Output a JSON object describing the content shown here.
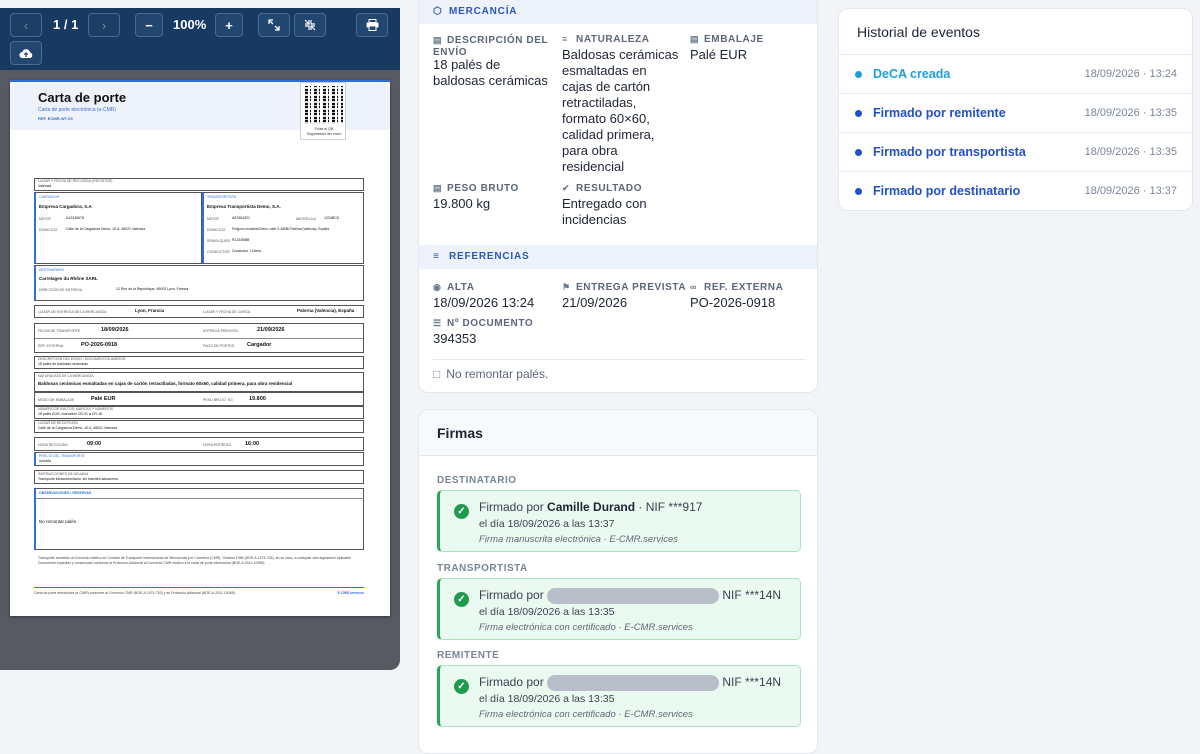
{
  "viewer": {
    "page_indicator": "1 / 1",
    "zoom": "100%",
    "prev_icon": "chevron-left-icon",
    "next_icon": "chevron-right-icon",
    "zoom_out_label": "−",
    "zoom_in_label": "+",
    "fullscreen_icon": "expand-icon",
    "fit_icon": "compress-icon",
    "print_icon": "print-icon",
    "upload_icon": "cloud-upload-icon"
  },
  "document": {
    "title": "Carta de porte",
    "subtitle": "Carta de porte electrónica (e-CMR)",
    "ref": "REF. ECMR-WT-03",
    "qr_caption": "Pulse el QR\nSeguimiento del envío",
    "lugar_recogida_label": "LUGAR Y FECHA DE RECOGIDA (REGISTER)",
    "lugar_recogida_value": "Valencia",
    "cargador_label": "CARGADOR",
    "cargador_name": "Empresa Cargadora, S.A",
    "cargador_nif_label": "NIF/CIF",
    "cargador_nif": "A12345678",
    "cargador_dom_label": "DOMICILIO",
    "cargador_dom": "Calle de la Cargadora Demo, 10-6, 46021 Valencia",
    "transportista_label": "TRANSPORTISTA",
    "transportista_name": "Empresa Transportista Demo, S.A.",
    "transportista_nif_label": "NIF/CIF",
    "transportista_nif": "A87654321",
    "transportista_mat_label": "MATRÍCULA",
    "transportista_mat": "1234BCD",
    "transportista_dom_label": "DOMICILIO",
    "transportista_dom": "Polígono Industrial Demo, calle 3, 46680 Paterna (Valencia), España",
    "transportista_rem_label": "REMOLQUE/S",
    "transportista_rem": "R1234BBB",
    "transportista_cond_label": "CONDUCTOR",
    "transportista_cond": "Conductor 1 Demo",
    "destinatario_label": "DESTINATARIO",
    "destinatario_name": "Carrelages du Rhône SARL",
    "destinatario_dir_label": "DIRECCIÓN DE ENTREGA",
    "destinatario_dir": "12 Rue de la République, 69002 Lyon, Francia",
    "entrega_label": "LUGAR DE ENTREGA DE LA MERCANCÍA",
    "entrega_value": "Lyon, Francia",
    "carga_label": "LUGAR Y FECHA DE CARGA",
    "carga_value": "Paterna (Valencia), España",
    "fecha_transp_label": "FECHA DE TRANSPORTE",
    "fecha_transp_value": "18/09/2026",
    "entrega_prev_label": "ENTREGA PREVISTA",
    "entrega_prev_value": "21/09/2026",
    "ref_ext_label": "REF. EXTERNA",
    "ref_ext_value": "PO-2026-0918",
    "portes_label": "PAGO DE PORTES",
    "portes_value": "Cargador",
    "desc_env_label": "DESCRIPCIÓN DEL ENVÍO / DOCUMENTOS ANEXOS",
    "desc_env_value": "18 palés de baldosas cerámicas",
    "naturaleza_label": "NATURALEZA DE LA MERCANCÍA",
    "naturaleza_value": "Baldosas cerámicas esmaltadas en cajas de cartón retractiladas, formato 60x60, calidad primera, para obra residencial",
    "embalaje_label": "MODO DE EMBALAJE",
    "embalaje_value": "Palé EUR",
    "peso_label": "PESO BRUTO, KG",
    "peso_value": "19.800",
    "bultos_label": "NÚMERO DE BULTOS, MARCAS Y NÚMEROS",
    "bultos_value": "18 palés EUR, marcados CR-01 a CR-18",
    "lugar_recep_label": "LUGAR DE RECEPCIÓN",
    "lugar_recep_value": "Calle de la Cargadora Demo, 10-6, 46021 Valencia",
    "hora_rec_label": "HORA RECOGIDA",
    "hora_rec_value": "09:00",
    "hora_ent_label": "HORA ENTREGA",
    "hora_ent_value": "16:00",
    "precio_label": "PRECIO DEL TRANSPORTE",
    "precio_value": "Incluido",
    "instr_label": "INSTRUCCIONES DE ADUANA",
    "instr_value": "Transporte intracomunitario; sin trámites aduaneros",
    "obs_label": "OBSERVACIONES / RESERVAS",
    "obs_value": "No remontar palés.",
    "legal": "Transporte sometido al Convenio relativo al Contrato de Transporte Internacional de Mercancías por Carretera (CMR), Ginebra 1956 (BOE-A-1974-753), en su caso, a cualquier otra legislación aplicable. Documento expedido y conservado conforme al Protocolo Adicional al Convenio CMR relativo a la carta de porte electrónica (BOE-A-2011-10065).",
    "footer_left": "Carta de porte electrónica (e-CMR) conforme al Convenio CMR (BOE-A-1974-753) y su Protocolo Adicional (BOE-A-2011-10065).",
    "footer_right": "E-CMR.services"
  },
  "mercancia": {
    "section_title": "MERCANCÍA",
    "desc_label": "DESCRIPCIÓN DEL ENVÍO",
    "desc_value": "18 palés de baldosas cerámicas",
    "naturaleza_label": "NATURALEZA",
    "naturaleza_value": "Baldosas cerámicas esmaltadas en cajas de cartón retractiladas, formato 60×60, calidad primera, para obra residencial",
    "embalaje_label": "EMBALAJE",
    "embalaje_value": "Palé EUR",
    "peso_label": "PESO BRUTO",
    "peso_value": "19.800 kg",
    "resultado_label": "RESULTADO",
    "resultado_value": "Entregado con incidencias"
  },
  "referencias": {
    "section_title": "REFERENCIAS",
    "alta_label": "ALTA",
    "alta_value": "18/09/2026 13:24",
    "entrega_label": "ENTREGA PREVISTA",
    "entrega_value": "21/09/2026",
    "ref_label": "REF. EXTERNA",
    "ref_value": "PO-2026-0918",
    "doc_label": "Nº DOCUMENTO",
    "doc_value": "394353",
    "note": "No remontar palés."
  },
  "firmas": {
    "title": "Firmas",
    "items": [
      {
        "role": "DESTINATARIO",
        "prefix": "Firmado por",
        "name": "Camille Durand",
        "nif": "· NIF ***917",
        "date": "el día 18/09/2026 a las 13:37",
        "method": "Firma manuscrita electrónica · E-CMR.services"
      },
      {
        "role": "TRANSPORTISTA",
        "prefix": "Firmado por",
        "nif": "NIF ***14N",
        "date": "el día 18/09/2026 a las 13:35",
        "method": "Firma electrónica con certificado · E-CMR.services"
      },
      {
        "role": "REMITENTE",
        "prefix": "Firmado por",
        "nif": "NIF ***14N",
        "date": "el día 18/09/2026 a las 13:35",
        "method": "Firma electrónica con certificado · E-CMR.services"
      }
    ]
  },
  "historial": {
    "title": "Historial de eventos",
    "items": [
      {
        "label": "DeCA creada",
        "time": "18/09/2026 · 13:24",
        "color": "#1ea0d8"
      },
      {
        "label": "Firmado por remitente",
        "time": "18/09/2026 · 13:35",
        "color": "#2250c8"
      },
      {
        "label": "Firmado por transportista",
        "time": "18/09/2026 · 13:35",
        "color": "#2250c8"
      },
      {
        "label": "Firmado por destinatario",
        "time": "18/09/2026 · 13:37",
        "color": "#2250c8"
      }
    ]
  }
}
